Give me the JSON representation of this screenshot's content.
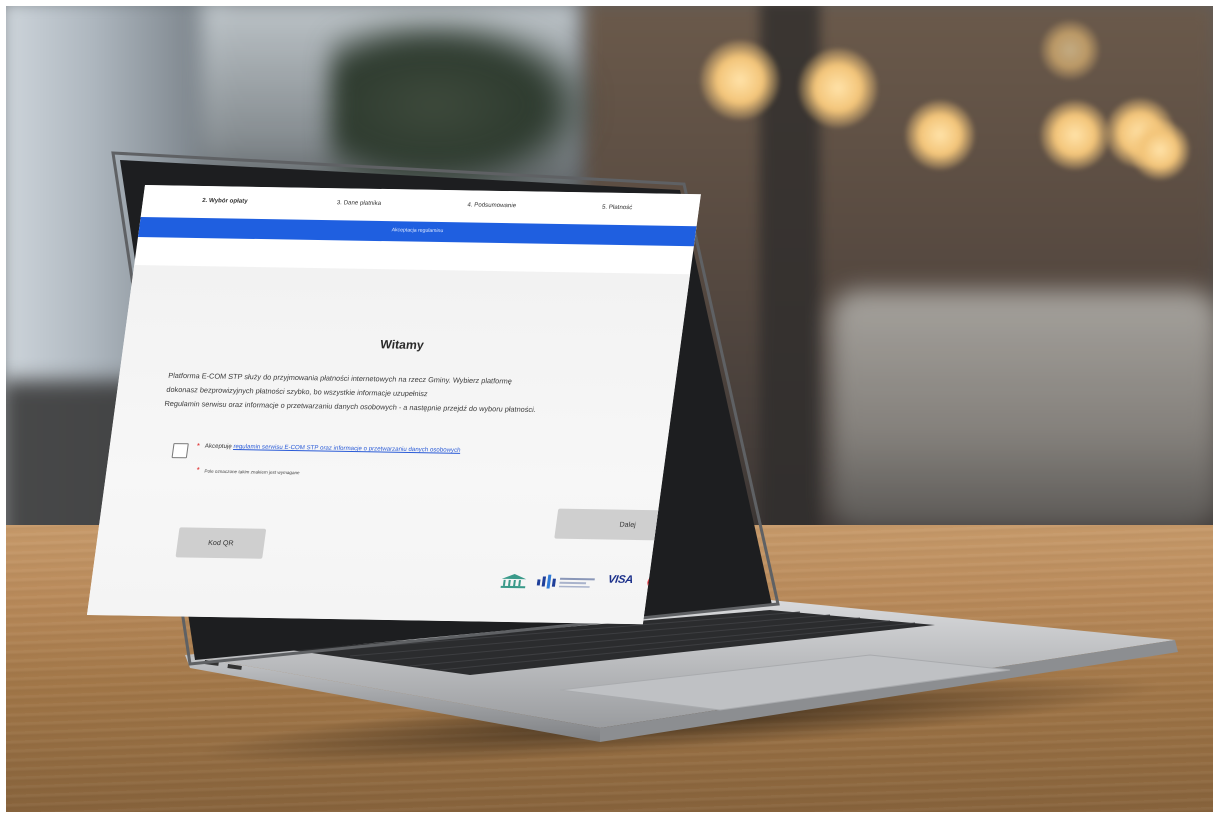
{
  "scene": {
    "description_objects": [
      "laptop",
      "wooden-table",
      "cafe-background"
    ]
  },
  "screen": {
    "steps": [
      {
        "label": "2. Wybór opłaty"
      },
      {
        "label": "3. Dane płatnika"
      },
      {
        "label": "4. Podsumowanie"
      },
      {
        "label": "5. Płatność"
      }
    ],
    "step_bar_label": "Akceptacja regulaminu",
    "welcome_title": "Witamy",
    "description_lines": [
      "Platforma E-COM STP służy do przyjmowania płatności internetowych na rzecz Gminy. Wybierz platformę",
      "dokonasz bezprowizyjnych płatności szybko, bo wszystkie informacje uzupełnisz",
      "Regulamin serwisu oraz informacje o przetwarzaniu danych osobowych - a następnie przejdź do wyboru płatności."
    ],
    "consent": {
      "prefix": "Akceptuję ",
      "link_text": "regulamin serwisu E-COM STP oraz informacje o przetwarzaniu danych osobowych"
    },
    "required_note": "Pole oznaczone takim znakiem jest wymagane",
    "buttons": {
      "next": "Dalej",
      "qr": "Kod QR"
    },
    "payment_logos": {
      "visa": "VISA"
    }
  }
}
